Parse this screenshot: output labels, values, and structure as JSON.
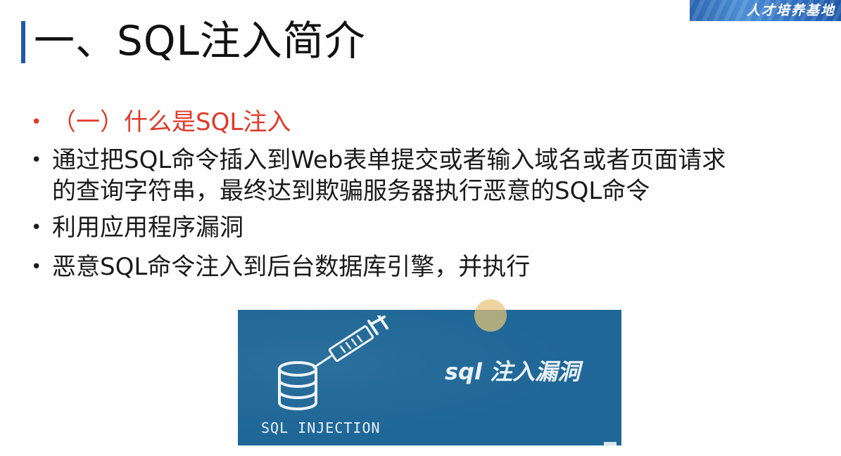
{
  "slide": {
    "title": "一、SQL注入简介",
    "banner_text": "人才培养基地",
    "accent_color": "#1e5aa8",
    "bullets": [
      {
        "text": "（一）什么是SQL注入",
        "color": "#e03a2a"
      },
      {
        "text": "通过把SQL命令插入到Web表单提交或者输入域名或者页面请求",
        "text2": "的查询字符串，最终达到欺骗服务器执行恶意的SQL命令"
      },
      {
        "text": "利用应用程序漏洞"
      },
      {
        "text": "恶意SQL命令注入到后台数据库引擎，并执行"
      }
    ],
    "bullet_glyph": "•",
    "image": {
      "title": "sql 注入漏洞",
      "caption": "SQL INJECTION",
      "background": "#1f6797",
      "icons": [
        "database-icon",
        "syringe-icon"
      ]
    }
  }
}
